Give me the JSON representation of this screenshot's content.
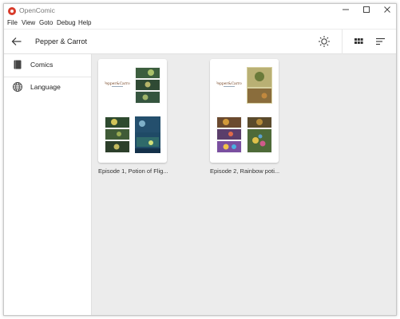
{
  "window": {
    "title": "OpenComic",
    "minimize": "—",
    "maximize": "☐",
    "close": "✕"
  },
  "menu": [
    "File",
    "View",
    "Goto",
    "Debug",
    "Help"
  ],
  "header": {
    "title": "Pepper & Carrot"
  },
  "sidebar": {
    "items": [
      {
        "label": "Comics",
        "icon": "book-icon"
      },
      {
        "label": "Language",
        "icon": "globe-icon"
      }
    ]
  },
  "comics": [
    {
      "label": "Episode 1, Potion of Flig..."
    },
    {
      "label": "Episode 2, Rainbow poti..."
    }
  ],
  "colors": {
    "accent": "#d83b2b",
    "content_bg": "#ececec"
  }
}
